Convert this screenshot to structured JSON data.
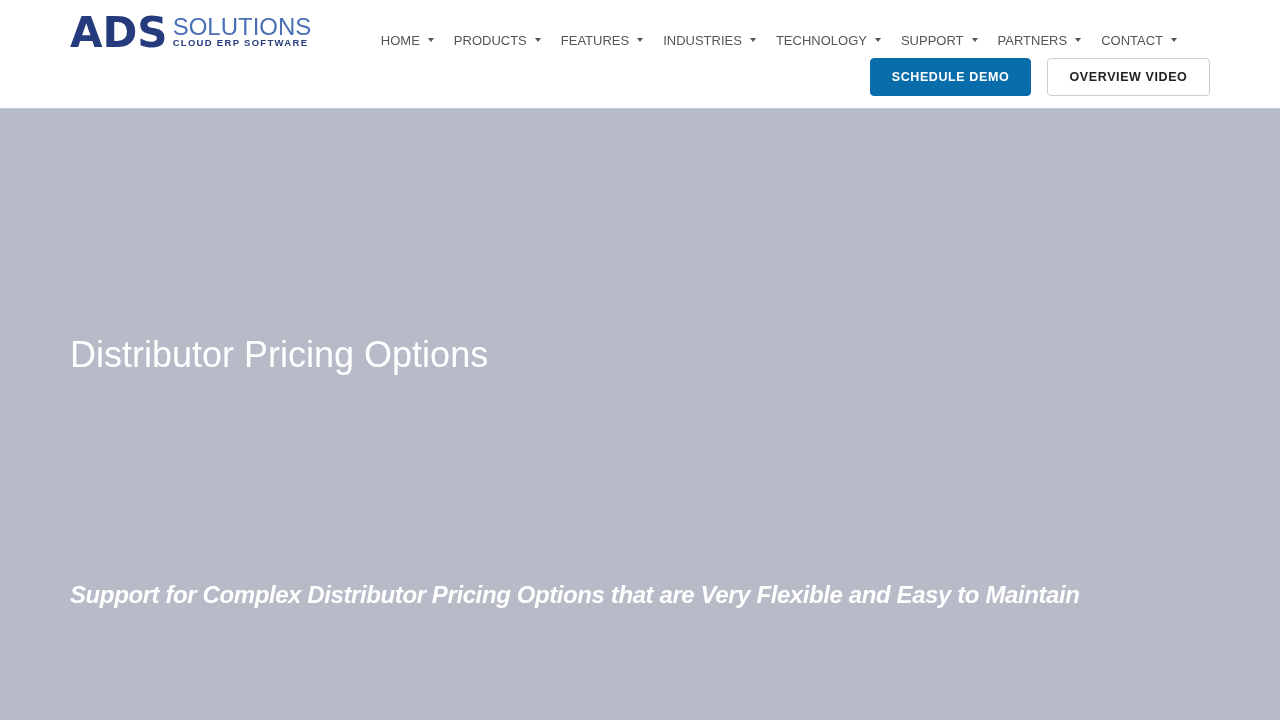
{
  "header": {
    "logo": {
      "mark": "ADS",
      "name": "SOLUTIONS",
      "tagline": "CLOUD ERP SOFTWARE"
    },
    "nav": [
      {
        "label": "HOME",
        "has_menu": true
      },
      {
        "label": "PRODUCTS",
        "has_menu": true
      },
      {
        "label": "FEATURES",
        "has_menu": true
      },
      {
        "label": "INDUSTRIES",
        "has_menu": true
      },
      {
        "label": "TECHNOLOGY",
        "has_menu": true
      },
      {
        "label": "SUPPORT",
        "has_menu": true
      },
      {
        "label": "PARTNERS",
        "has_menu": true
      },
      {
        "label": "CONTACT",
        "has_menu": true
      }
    ],
    "buttons": [
      {
        "label": "SCHEDULE DEMO",
        "kind": "primary"
      },
      {
        "label": "OVERVIEW VIDEO",
        "kind": "outline"
      }
    ]
  },
  "hero": {
    "title": "Distributor Pricing Options",
    "subtitle": "Support for Complex Distributor Pricing Options that are Very Flexible and Easy to Maintain"
  }
}
